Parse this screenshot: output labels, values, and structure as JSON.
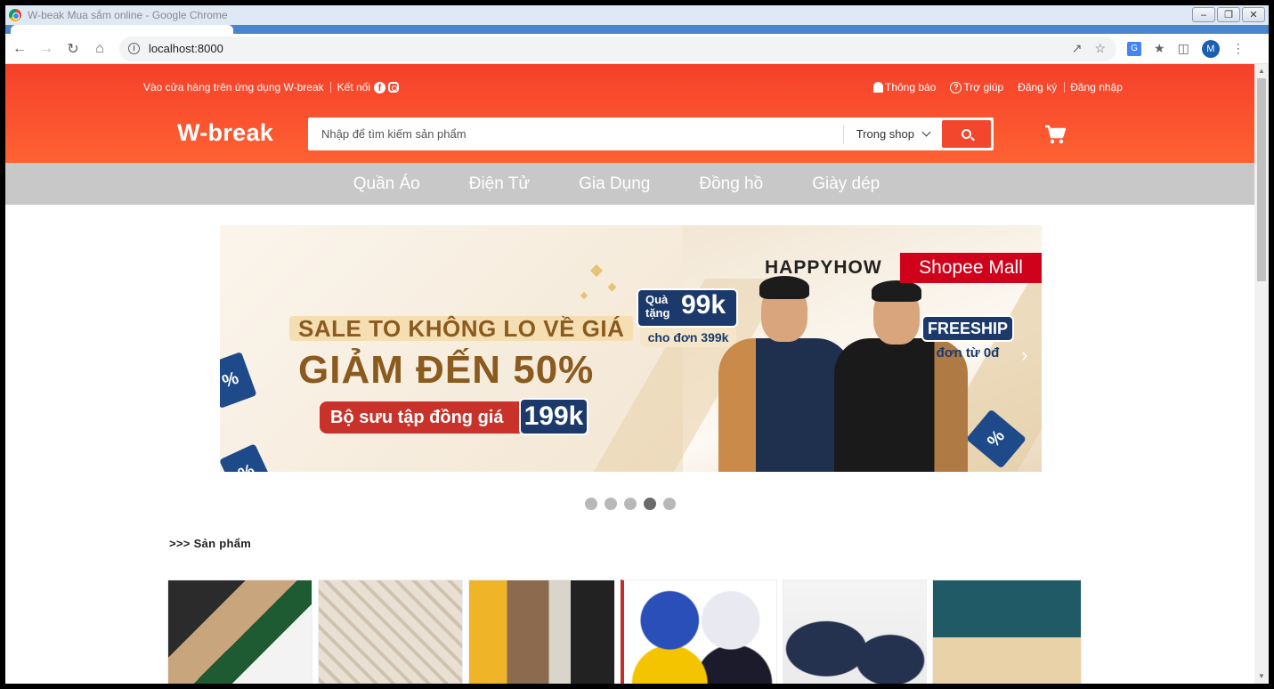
{
  "browser": {
    "window_title": "W-beak Mua sắm online - Google Chrome",
    "url": "localhost:8000",
    "profile_initial": "M"
  },
  "header": {
    "download_app": "Vào cửa hàng trên ứng dụng W-break",
    "connect": "Kết nối",
    "notifications": "Thông báo",
    "help": "Trợ giúp",
    "register": "Đăng ký",
    "login": "Đăng nhập",
    "logo": "W-break",
    "search_placeholder": "Nhập để tìm kiếm sản phẩm",
    "search_scope": "Trong shop"
  },
  "categories": [
    "Quần Áo",
    "Điện Tử",
    "Gia Dụng",
    "Đồng hồ",
    "Giày dép"
  ],
  "banner": {
    "sale_line": "SALE TO KHÔNG LO VỀ GIÁ",
    "discount_line": "GIẢM ĐẾN 50%",
    "collection": "Bộ sưu tập đồng giá",
    "collection_price": "199k",
    "gift_label": "Quà tặng",
    "gift_value": "99k",
    "gift_condition": "cho đơn 399k",
    "brand": "HAPPYHOW",
    "mall": "Shopee Mall",
    "freeship": "FREESHIP",
    "freeship_condition": "đơn từ 0đ",
    "pct": "%"
  },
  "carousel": {
    "slides": 5,
    "active_index": 3
  },
  "products_section": {
    "title": ">>> Sản phẩm"
  },
  "colors": {
    "header_top": "#f5402a",
    "header_bottom": "#fe6232",
    "category_bar": "#c8c8c8",
    "search_button": "#f2472c"
  }
}
